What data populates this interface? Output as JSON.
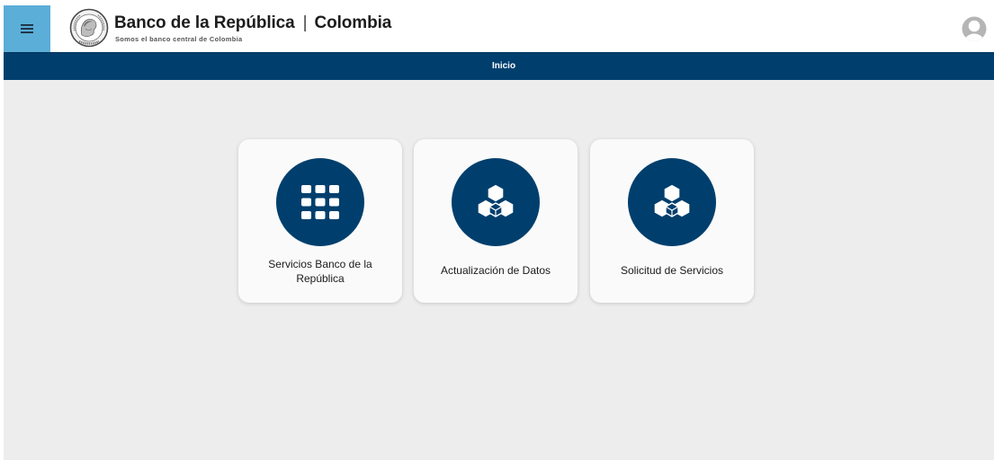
{
  "header": {
    "menu_icon": "hamburger-menu-icon",
    "logo_icon": "banco-seal-logo",
    "title_main": "Banco de la República",
    "title_separator": "|",
    "title_country": "Colombia",
    "subtitle": "Somos el banco central de Colombia",
    "user_icon": "user-avatar-icon"
  },
  "nav": {
    "items": [
      {
        "label": "Inicio"
      }
    ]
  },
  "cards": [
    {
      "label": "Servicios Banco de la República",
      "icon": "apps-grid-icon"
    },
    {
      "label": "Actualización de Datos",
      "icon": "cubes-icon"
    },
    {
      "label": "Solicitud de Servicios",
      "icon": "cubes-icon"
    }
  ],
  "colors": {
    "primary": "#003f6d",
    "menu_button": "#5aaed8",
    "background": "#ededed",
    "card": "#fafafa"
  }
}
